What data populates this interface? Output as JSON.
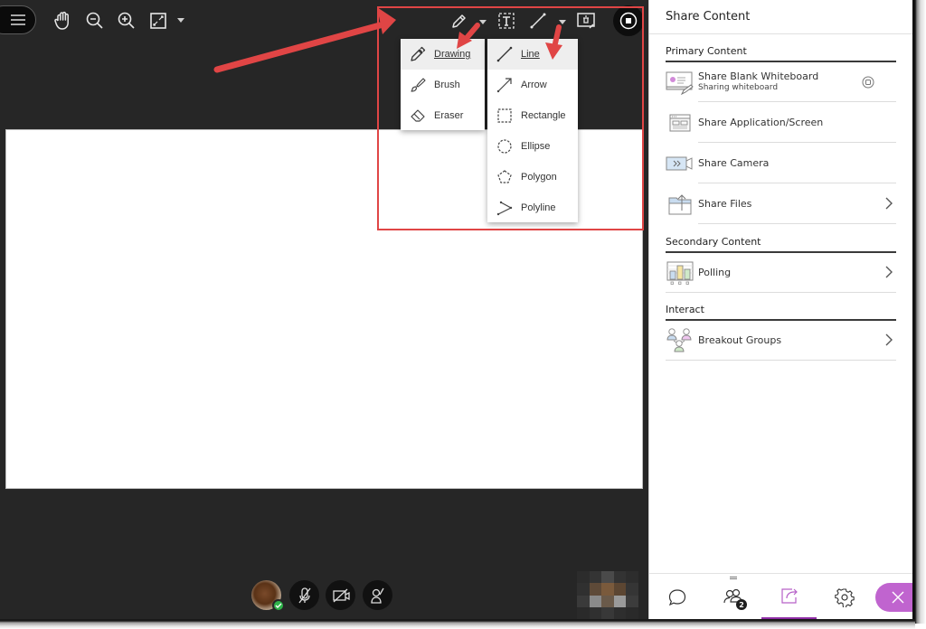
{
  "toolbar": {
    "left_tools": [
      {
        "name": "menu-icon"
      },
      {
        "name": "hand-pan-icon"
      },
      {
        "name": "zoom-out-icon"
      },
      {
        "name": "zoom-in-icon"
      },
      {
        "name": "fit-screen-icon"
      },
      {
        "name": "caret-down-icon"
      }
    ],
    "right_tools": [
      {
        "name": "pencil-icon"
      },
      {
        "name": "text-tool-icon"
      },
      {
        "name": "line-tool-icon"
      },
      {
        "name": "clear-whiteboard-icon"
      },
      {
        "name": "stop-sharing-icon"
      }
    ]
  },
  "drawing_menu": {
    "items": [
      {
        "label": "Drawing",
        "icon": "pencil-icon",
        "selected": true
      },
      {
        "label": "Brush",
        "icon": "brush-icon",
        "selected": false
      },
      {
        "label": "Eraser",
        "icon": "eraser-icon",
        "selected": false
      }
    ]
  },
  "shape_menu": {
    "items": [
      {
        "label": "Line",
        "icon": "line-icon",
        "selected": true
      },
      {
        "label": "Arrow",
        "icon": "arrow-icon",
        "selected": false
      },
      {
        "label": "Rectangle",
        "icon": "rectangle-icon",
        "selected": false
      },
      {
        "label": "Ellipse",
        "icon": "ellipse-icon",
        "selected": false
      },
      {
        "label": "Polygon",
        "icon": "polygon-icon",
        "selected": false
      },
      {
        "label": "Polyline",
        "icon": "polyline-icon",
        "selected": false
      }
    ]
  },
  "annotation": {
    "color": "#e04545"
  },
  "bottom_controls": {
    "status_icon": "check-icon",
    "mic": "microphone-off-icon",
    "camera": "camera-off-icon",
    "hand": "raise-hand-icon"
  },
  "panel": {
    "title": "Share Content",
    "sections": [
      {
        "heading": "Primary Content",
        "items": [
          {
            "label": "Share Blank Whiteboard",
            "sublabel": "Sharing whiteboard",
            "icon": "whiteboard-icon",
            "action": "stop-share-icon"
          },
          {
            "label": "Share Application/Screen",
            "icon": "screen-share-icon"
          },
          {
            "label": "Share Camera",
            "icon": "camera-share-icon"
          },
          {
            "label": "Share Files",
            "icon": "folder-upload-icon",
            "action": "chevron-right-icon"
          }
        ]
      },
      {
        "heading": "Secondary Content",
        "items": [
          {
            "label": "Polling",
            "icon": "polling-icon",
            "action": "chevron-right-icon"
          }
        ]
      },
      {
        "heading": "Interact",
        "items": [
          {
            "label": "Breakout Groups",
            "icon": "breakout-groups-icon",
            "action": "chevron-right-icon"
          }
        ]
      }
    ],
    "tabs": [
      {
        "name": "chat-icon",
        "active": false
      },
      {
        "name": "attendees-icon",
        "badge": "2",
        "active": false
      },
      {
        "name": "share-content-icon",
        "active": true
      },
      {
        "name": "settings-icon",
        "active": false
      }
    ],
    "accent": "#8e2ca5",
    "close_color": "#c064cf"
  }
}
